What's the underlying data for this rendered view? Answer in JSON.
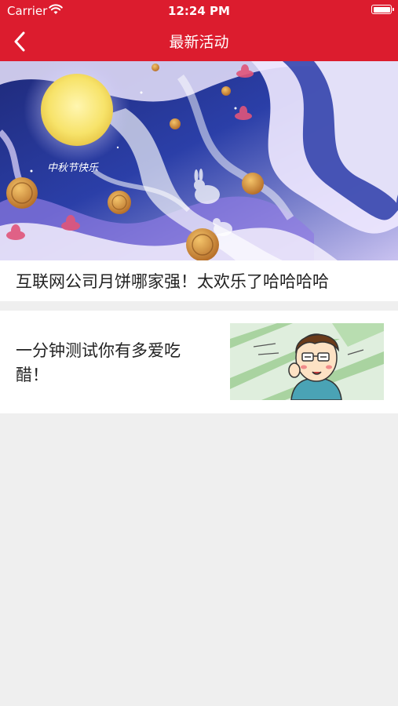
{
  "status_bar": {
    "carrier": "Carrier",
    "time": "12:24 PM"
  },
  "nav": {
    "title": "最新活动",
    "back_icon": "chevron-left-icon"
  },
  "colors": {
    "header_red": "#dc1c2e",
    "background": "#efefef",
    "card": "#ffffff",
    "text": "#222222"
  },
  "activities": [
    {
      "title": "互联网公司月饼哪家强！太欢乐了哈哈哈哈",
      "image": "mid-autumn-moon-illustration",
      "image_caption": "中秋节快乐"
    },
    {
      "title": "一分钟测试你有多爱吃醋！",
      "image": "cartoon-man-with-glasses"
    }
  ]
}
